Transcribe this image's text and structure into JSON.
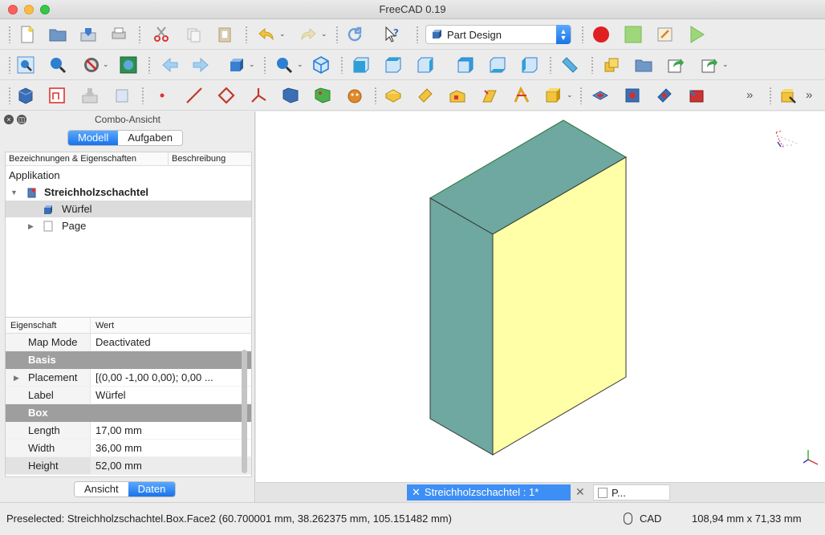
{
  "window": {
    "title": "FreeCAD 0.19"
  },
  "toolbar": {
    "workbench": "Part Design",
    "more_label": "»"
  },
  "combo": {
    "title": "Combo-Ansicht",
    "tabs": [
      "Modell",
      "Aufgaben"
    ],
    "tree_headers": [
      "Bezeichnungen & Eigenschaften",
      "Beschreibung"
    ],
    "tree": {
      "root_label": "Applikation",
      "document": "Streichholzschachtel",
      "items": [
        {
          "label": "Würfel",
          "selected": true
        },
        {
          "label": "Page",
          "selected": false
        }
      ]
    },
    "property_headers": [
      "Eigenschaft",
      "Wert"
    ],
    "properties": {
      "map_mode": {
        "key": "Map Mode",
        "value": "Deactivated"
      },
      "group_basis": "Basis",
      "placement": {
        "key": "Placement",
        "value": "[(0,00 -1,00 0,00); 0,00 ..."
      },
      "label": {
        "key": "Label",
        "value": "Würfel"
      },
      "group_box": "Box",
      "length": {
        "key": "Length",
        "value": "17,00 mm"
      },
      "width": {
        "key": "Width",
        "value": "36,00 mm"
      },
      "height": {
        "key": "Height",
        "value": "52,00 mm"
      }
    },
    "bottom_tabs": [
      "Ansicht",
      "Daten"
    ]
  },
  "view": {
    "colors": {
      "top": "#6ea8a0",
      "left": "#6ea8a0",
      "front": "#ffffa8",
      "edge": "#3a7d4a"
    }
  },
  "doc_tabs": {
    "active": "Streichholzschachtel : 1*",
    "other": "P..."
  },
  "status": {
    "preselected": "Preselected: Streichholzschachtel.Box.Face2 (60.700001 mm, 38.262375 mm, 105.151482 mm)",
    "nav_style": "CAD",
    "dimensions": "108,94 mm x 71,33 mm"
  }
}
